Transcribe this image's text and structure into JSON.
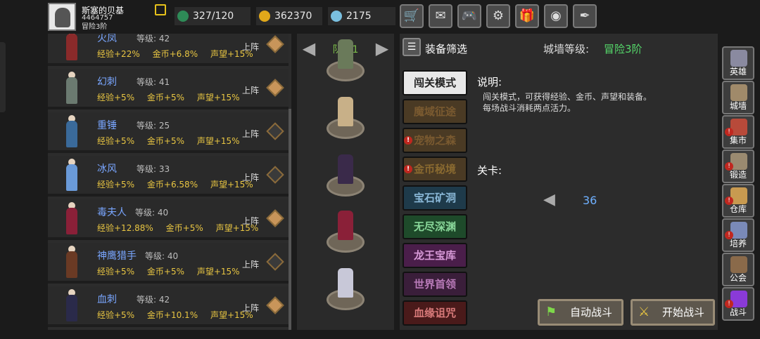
{
  "player": {
    "name": "斯塞的贝基",
    "id": "4464757",
    "rank": "冒险3阶"
  },
  "resources": {
    "energy": "327/120",
    "gold": "362370",
    "gems": "2175"
  },
  "top_buttons": [
    "shop-cart-icon",
    "mail-icon",
    "gamepad-icon",
    "gear-icon",
    "gift-icon",
    "color-wheel-icon",
    "feather-icon"
  ],
  "heroes": [
    {
      "name": "火凤",
      "level": "等级: 42",
      "exp": "经验+22%",
      "gold": "金币+6.8%",
      "fame": "声望+15%",
      "deploy": "上阵",
      "deployed": true,
      "color": "#8a2a2a"
    },
    {
      "name": "幻刺",
      "level": "等级: 41",
      "exp": "经验+5%",
      "gold": "金币+5%",
      "fame": "声望+15%",
      "deploy": "上阵",
      "deployed": true,
      "color": "#6b7a70"
    },
    {
      "name": "重锤",
      "level": "等级: 25",
      "exp": "经验+5%",
      "gold": "金币+5%",
      "fame": "声望+15%",
      "deploy": "上阵",
      "deployed": false,
      "color": "#3a6a9a"
    },
    {
      "name": "冰风",
      "level": "等级: 33",
      "exp": "经验+5%",
      "gold": "金币+6.58%",
      "fame": "声望+15%",
      "deploy": "上阵",
      "deployed": false,
      "color": "#6a9ad8"
    },
    {
      "name": "毒夫人",
      "level": "等级: 40",
      "exp": "经验+12.88%",
      "gold": "金币+5%",
      "fame": "声望+15%",
      "deploy": "上阵",
      "deployed": true,
      "color": "#8a2038"
    },
    {
      "name": "神鹰猎手",
      "level": "等级: 40",
      "exp": "经验+5%",
      "gold": "金币+5%",
      "fame": "声望+15%",
      "deploy": "上阵",
      "deployed": false,
      "color": "#6a3a24"
    },
    {
      "name": "血刺",
      "level": "等级: 42",
      "exp": "经验+5%",
      "gold": "金币+10.1%",
      "fame": "声望+15%",
      "deploy": "上阵",
      "deployed": true,
      "color": "#2a2a4a"
    }
  ],
  "team": {
    "title": "队伍1",
    "members": [
      "#6a7a5a",
      "#c8b088",
      "#3a2a4a",
      "#8a2038",
      "#c8c8d8"
    ]
  },
  "panel": {
    "filter_label": "装备筛选",
    "wall_label": "城墙等级:",
    "wall_value": "冒险3阶",
    "desc_title": "说明:",
    "desc_line1": "闯关模式，可获得经验、金币、声望和装备。",
    "desc_line2": "每场战斗消耗两点活力。",
    "stage_label": "关卡:",
    "stage_number": "36",
    "auto_battle": "自动战斗",
    "start_battle": "开始战斗"
  },
  "modes": [
    {
      "label": "闯关模式",
      "bg": "#e8e8e8",
      "fg": "#222",
      "alert": false
    },
    {
      "label": "魔域征途",
      "bg": "#4a3a24",
      "fg": "#7a5a30",
      "alert": false
    },
    {
      "label": "宠物之森",
      "bg": "#4a3a24",
      "fg": "#7a5a30",
      "alert": true
    },
    {
      "label": "金币秘境",
      "bg": "#4a3a24",
      "fg": "#8a6a30",
      "alert": true
    },
    {
      "label": "宝石矿洞",
      "bg": "#1e3a4a",
      "fg": "#8ab8d8",
      "alert": false
    },
    {
      "label": "无尽深渊",
      "bg": "#1e4a2a",
      "fg": "#8ad89a",
      "alert": false
    },
    {
      "label": "龙王宝库",
      "bg": "#4a1e4a",
      "fg": "#d89ad8",
      "alert": false
    },
    {
      "label": "世界首领",
      "bg": "#3a1e3a",
      "fg": "#b87ab8",
      "alert": false
    },
    {
      "label": "血缘诅咒",
      "bg": "#4a1a1a",
      "fg": "#d87a7a",
      "alert": false
    }
  ],
  "side_nav": [
    {
      "label": "英雄",
      "icon": "helmet-icon",
      "color": "#8a8aa0",
      "alert": false
    },
    {
      "label": "城墙",
      "icon": "wall-icon",
      "color": "#a08a6a",
      "alert": false
    },
    {
      "label": "集市",
      "icon": "market-icon",
      "color": "#b84a3a",
      "alert": true
    },
    {
      "label": "锻造",
      "icon": "anvil-icon",
      "color": "#9a8a70",
      "alert": true
    },
    {
      "label": "仓库",
      "icon": "chest-icon",
      "color": "#c89a50",
      "alert": true
    },
    {
      "label": "培养",
      "icon": "train-icon",
      "color": "#7a8ab8",
      "alert": true
    },
    {
      "label": "公会",
      "icon": "guild-icon",
      "color": "#8a6a4a",
      "alert": false
    },
    {
      "label": "战斗",
      "icon": "portal-icon",
      "color": "#8a3ad8",
      "alert": true
    }
  ]
}
